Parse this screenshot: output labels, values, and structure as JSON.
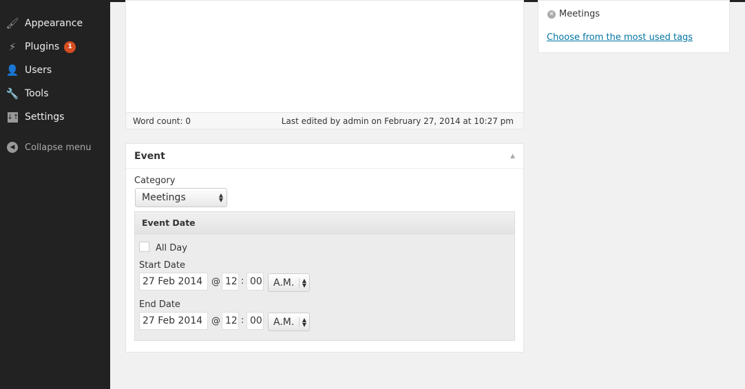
{
  "sidebar": {
    "items": [
      {
        "label": "Appearance",
        "icon": "paintbrush-icon"
      },
      {
        "label": "Plugins",
        "icon": "plug-icon",
        "badge": "1"
      },
      {
        "label": "Users",
        "icon": "user-icon"
      },
      {
        "label": "Tools",
        "icon": "wrench-icon"
      },
      {
        "label": "Settings",
        "icon": "settings-sliders-icon"
      }
    ],
    "collapse": "Collapse menu"
  },
  "editor": {
    "word_count": "Word count: 0",
    "last_edited": "Last edited by admin on February 27, 2014 at 10:27 pm"
  },
  "tags": {
    "tag": "Meetings",
    "choose_link": "Choose from the most used tags"
  },
  "event": {
    "title": "Event",
    "category_label": "Category",
    "category_value": "Meetings",
    "date_section": "Event Date",
    "all_day": "All Day",
    "start": {
      "label": "Start Date",
      "date": "27 Feb 2014",
      "at": "@",
      "hour": "12",
      "sep": ":",
      "minute": "00",
      "ampm": "A.M."
    },
    "end": {
      "label": "End Date",
      "date": "27 Feb 2014",
      "at": "@",
      "hour": "12",
      "sep": ":",
      "minute": "00",
      "ampm": "A.M."
    }
  },
  "colors": {
    "sidebar": "#222222",
    "badge": "#d54e21",
    "link": "#0074a2"
  }
}
